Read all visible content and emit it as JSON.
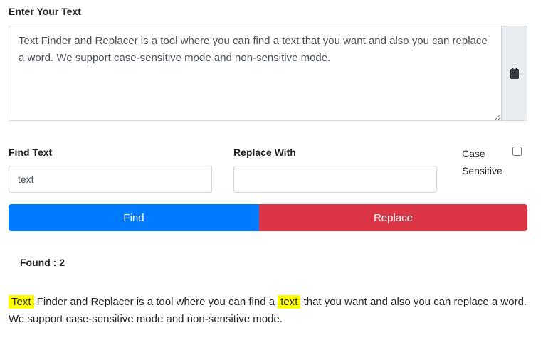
{
  "editor": {
    "label": "Enter Your Text",
    "text": "Text Finder and Replacer is a tool where you can find a text that you want and also you can replace a word. We support case-sensitive mode and non-sensitive mode.",
    "paste_icon": "clipboard-icon"
  },
  "find": {
    "label": "Find Text",
    "value": "text"
  },
  "replace": {
    "label": "Replace With",
    "value": ""
  },
  "case_sensitive": {
    "label": "Case Sensitive",
    "checked": false
  },
  "buttons": {
    "find_label": "Find",
    "replace_label": "Replace",
    "find_color": "#007bff",
    "replace_color": "#dc3545"
  },
  "result": {
    "found_label": "Found : 2",
    "segments": [
      {
        "text": "Text",
        "highlight": true
      },
      {
        "text": " Finder and Replacer is a tool where you can find a ",
        "highlight": false
      },
      {
        "text": "text",
        "highlight": true
      },
      {
        "text": " that you want and also you can replace a word. We support case-sensitive mode and non-sensitive mode.",
        "highlight": false
      }
    ],
    "highlight_color": "#ffff00"
  }
}
